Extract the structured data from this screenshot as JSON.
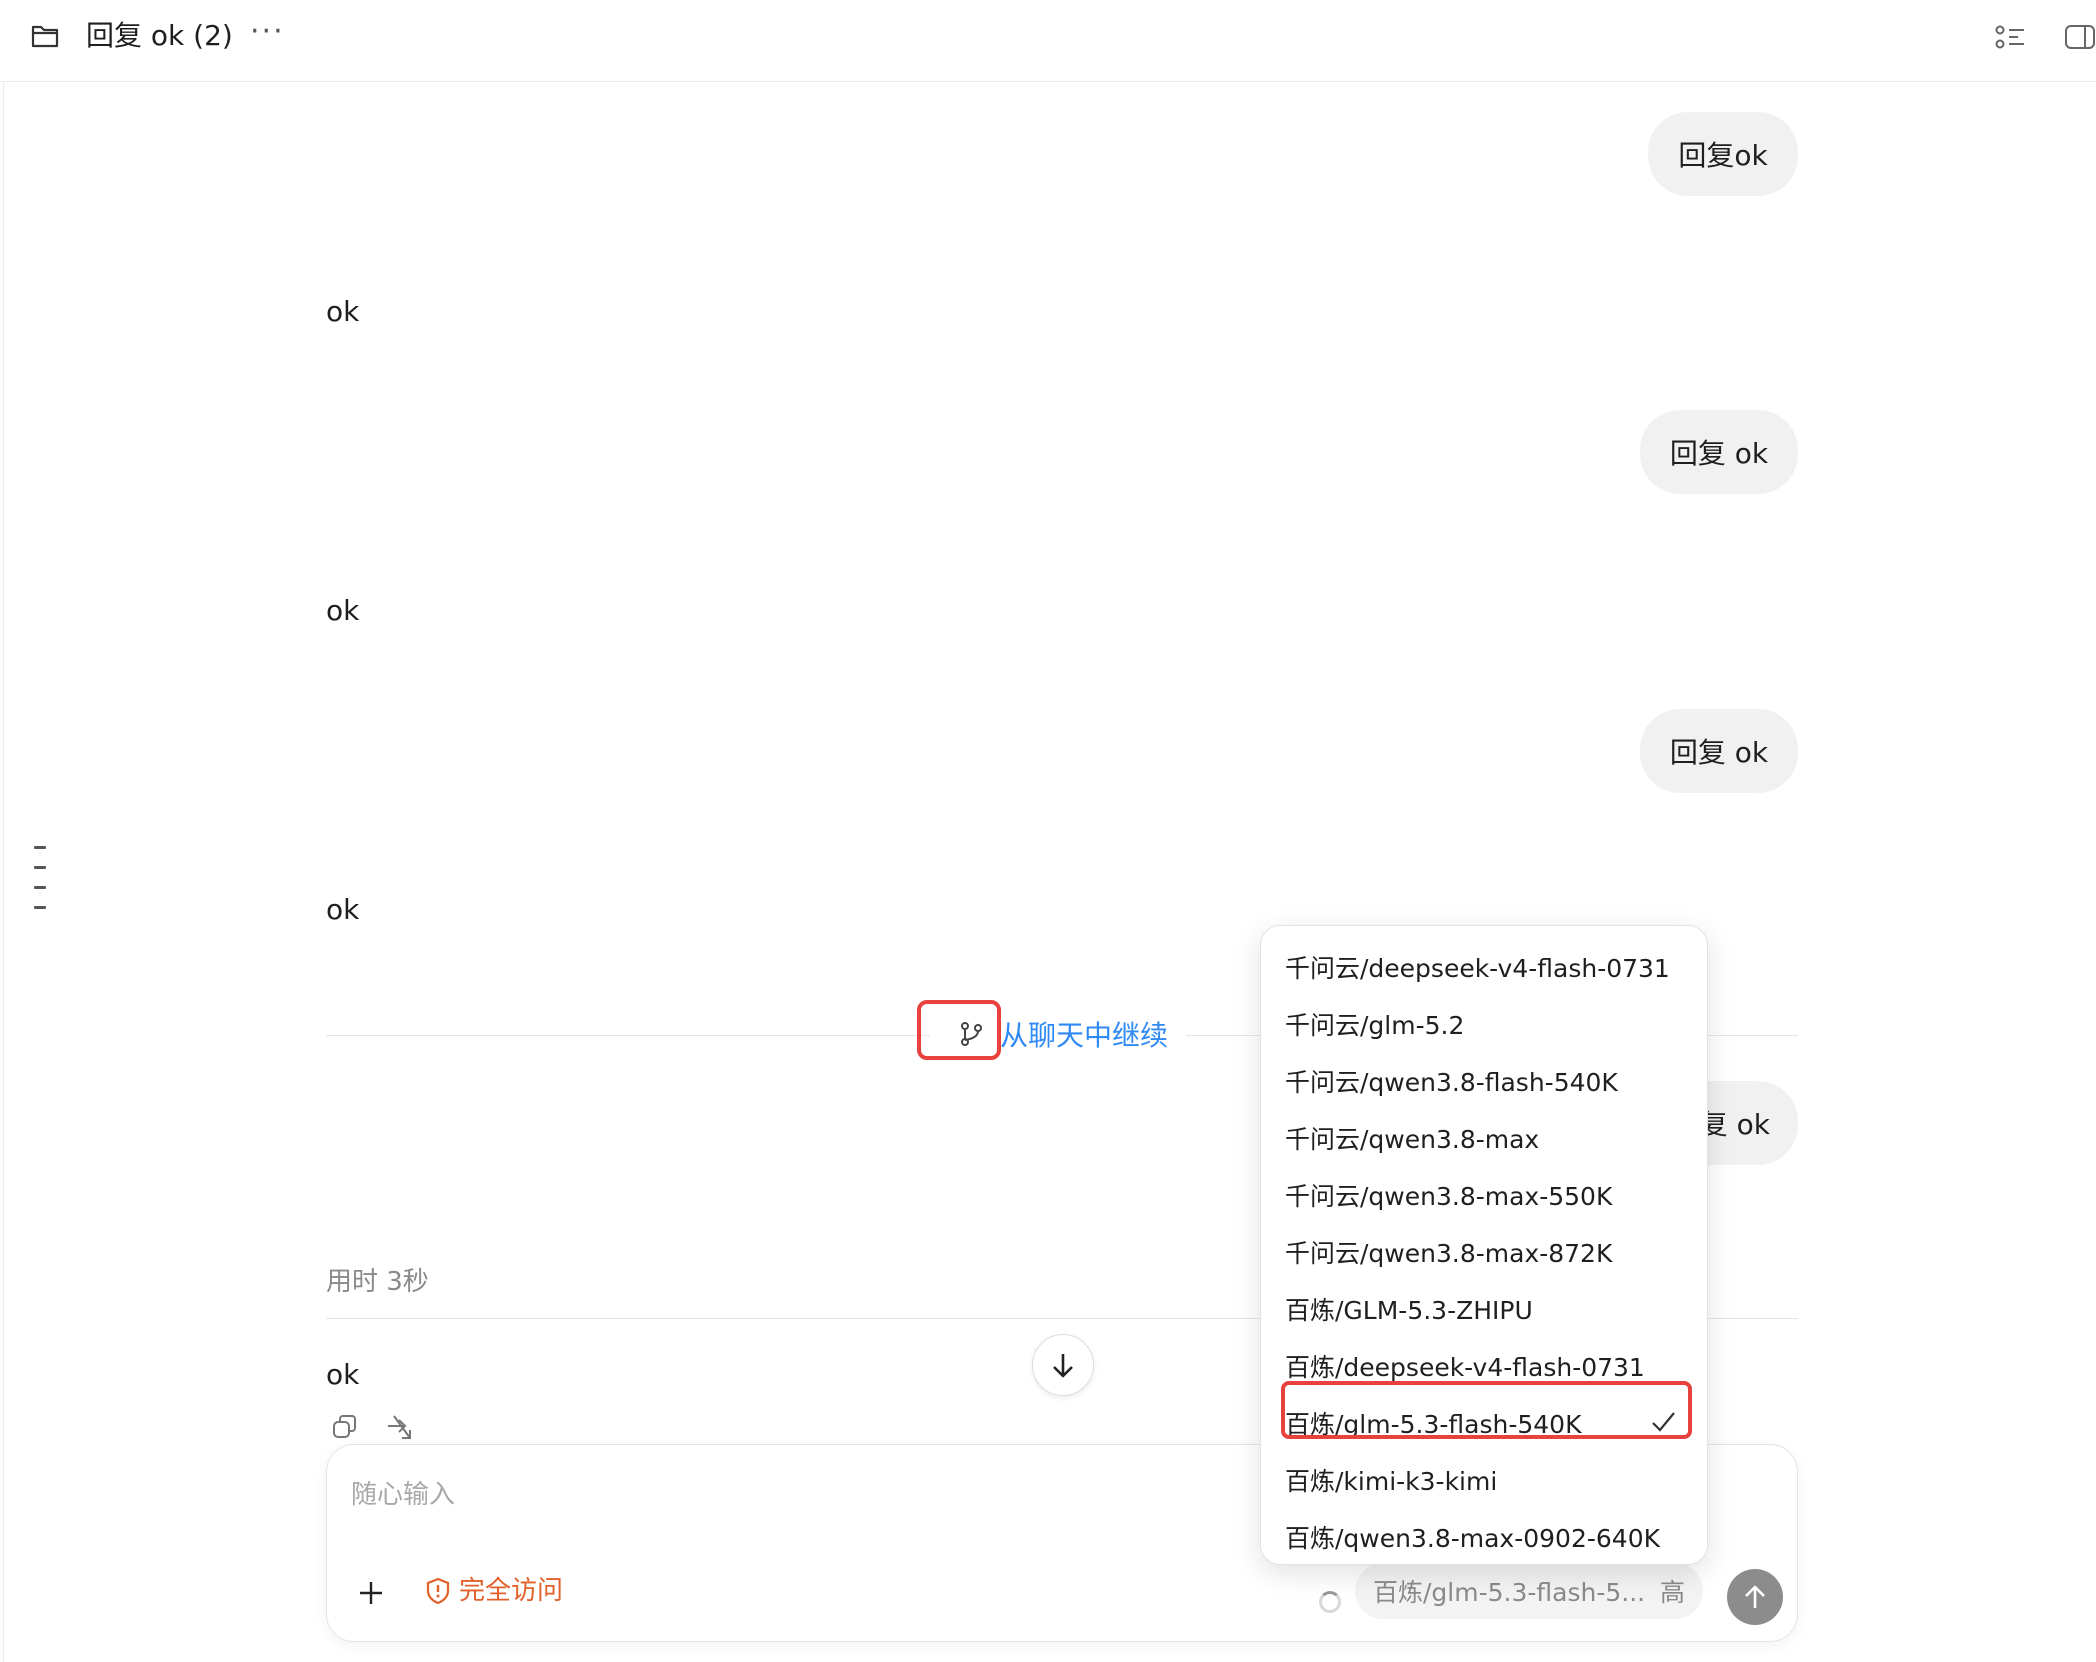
{
  "header": {
    "title": "回复 ok (2)",
    "more": "···"
  },
  "messages": [
    {
      "role": "user",
      "text": "回复ok"
    },
    {
      "role": "assistant",
      "text": "ok"
    },
    {
      "role": "user",
      "text": "回复 ok"
    },
    {
      "role": "assistant",
      "text": "ok"
    },
    {
      "role": "user",
      "text": "回复 ok"
    },
    {
      "role": "assistant",
      "text": "ok"
    },
    {
      "role": "user",
      "text": "复 ok"
    },
    {
      "role": "assistant",
      "text": "ok"
    }
  ],
  "branch": {
    "label": "从聊天中继续"
  },
  "timing": {
    "label": "用时 3秒"
  },
  "composer": {
    "placeholder": "随心输入",
    "access_label": "完全访问",
    "model_label": "百炼/glm-5.3-flash-5...",
    "effort_label": "高"
  },
  "model_menu": {
    "items": [
      "千问云/deepseek-v4-flash-0731",
      "千问云/glm-5.2",
      "千问云/qwen3.8-flash-540K",
      "千问云/qwen3.8-max",
      "千问云/qwen3.8-max-550K",
      "千问云/qwen3.8-max-872K",
      "百炼/GLM-5.3-ZHIPU",
      "百炼/deepseek-v4-flash-0731",
      "百炼/glm-5.3-flash-540K",
      "百炼/kimi-k3-kimi",
      "百炼/qwen3.8-max-0902-640K"
    ],
    "selected_index": 8
  },
  "colors": {
    "accent_link": "#2f8af5",
    "highlight": "#e8413e",
    "warning": "#e2602a"
  }
}
